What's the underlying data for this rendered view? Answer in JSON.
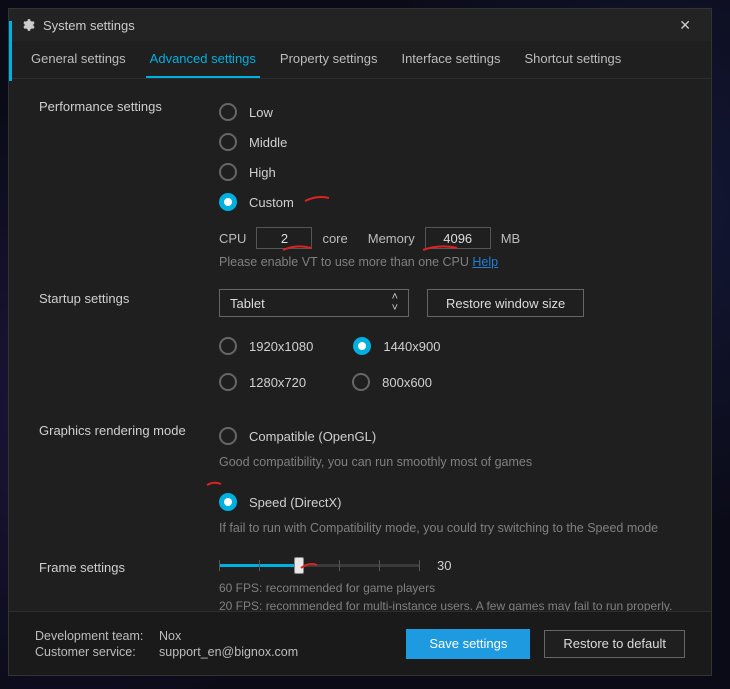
{
  "window": {
    "title": "System settings"
  },
  "tabs": {
    "general": "General settings",
    "advanced": "Advanced settings",
    "property": "Property settings",
    "interface": "Interface settings",
    "shortcut": "Shortcut settings"
  },
  "perf": {
    "heading": "Performance settings",
    "options": {
      "low": "Low",
      "middle": "Middle",
      "high": "High",
      "custom": "Custom"
    },
    "cpu_label": "CPU",
    "cpu_value": "2",
    "core_label": "core",
    "mem_label": "Memory",
    "mem_value": "4096",
    "mb_label": "MB",
    "vt_hint": "Please enable VT to use more than one CPU",
    "help": "Help"
  },
  "startup": {
    "heading": "Startup settings",
    "select_value": "Tablet",
    "restore_btn": "Restore window size",
    "res": {
      "r1": "1920x1080",
      "r2": "1440x900",
      "r3": "1280x720",
      "r4": "800x600"
    }
  },
  "graphics": {
    "heading": "Graphics rendering mode",
    "compat": "Compatible (OpenGL)",
    "compat_hint": "Good compatibility, you can run smoothly most of games",
    "speed": "Speed (DirectX)",
    "speed_hint": "If fail to run with Compatibility mode, you could try switching to the Speed mode"
  },
  "frame": {
    "heading": "Frame settings",
    "value": "30",
    "hint60": "60 FPS: recommended for game players",
    "hint20": "20 FPS: recommended for multi-instance users. A few games may fail to run properly."
  },
  "footer": {
    "dev_label": "Development team:",
    "dev_value": "Nox",
    "cs_label": "Customer service:",
    "cs_value": "support_en@bignox.com",
    "save": "Save settings",
    "restore": "Restore to default"
  }
}
